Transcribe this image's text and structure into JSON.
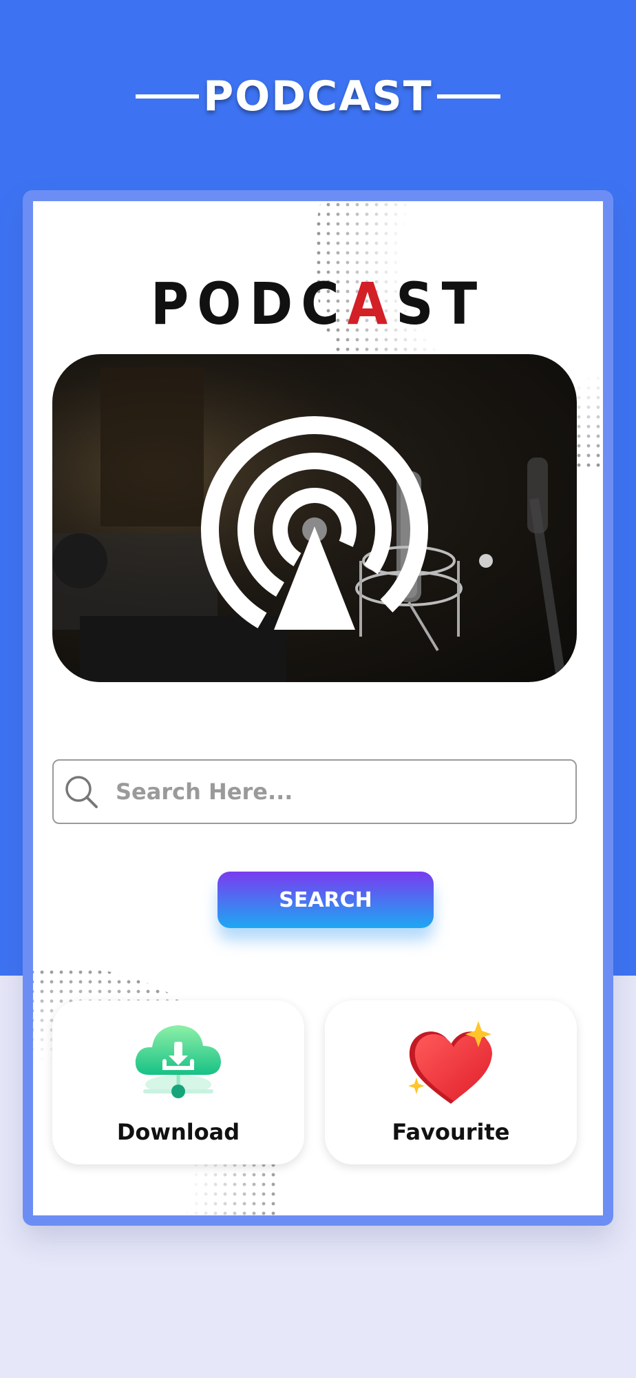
{
  "header": {
    "title": "PODCAST"
  },
  "logo": {
    "text_before": "PODC",
    "text_accent": "A",
    "text_after": "ST"
  },
  "hero": {
    "image": "podcast-studio-microphone"
  },
  "search": {
    "placeholder": "Search Here...",
    "value": "",
    "button_label": "SEARCH"
  },
  "actions": {
    "download": {
      "label": "Download",
      "icon": "cloud-download-icon"
    },
    "favourite": {
      "label": "Favourite",
      "icon": "heart-icon"
    }
  },
  "colors": {
    "primary_blue": "#3d73f2",
    "logo_accent": "#d31f26",
    "button_gradient_top": "#7a3bf0",
    "button_gradient_bottom": "#1da8f2",
    "page_bg": "#e6e7f8"
  }
}
